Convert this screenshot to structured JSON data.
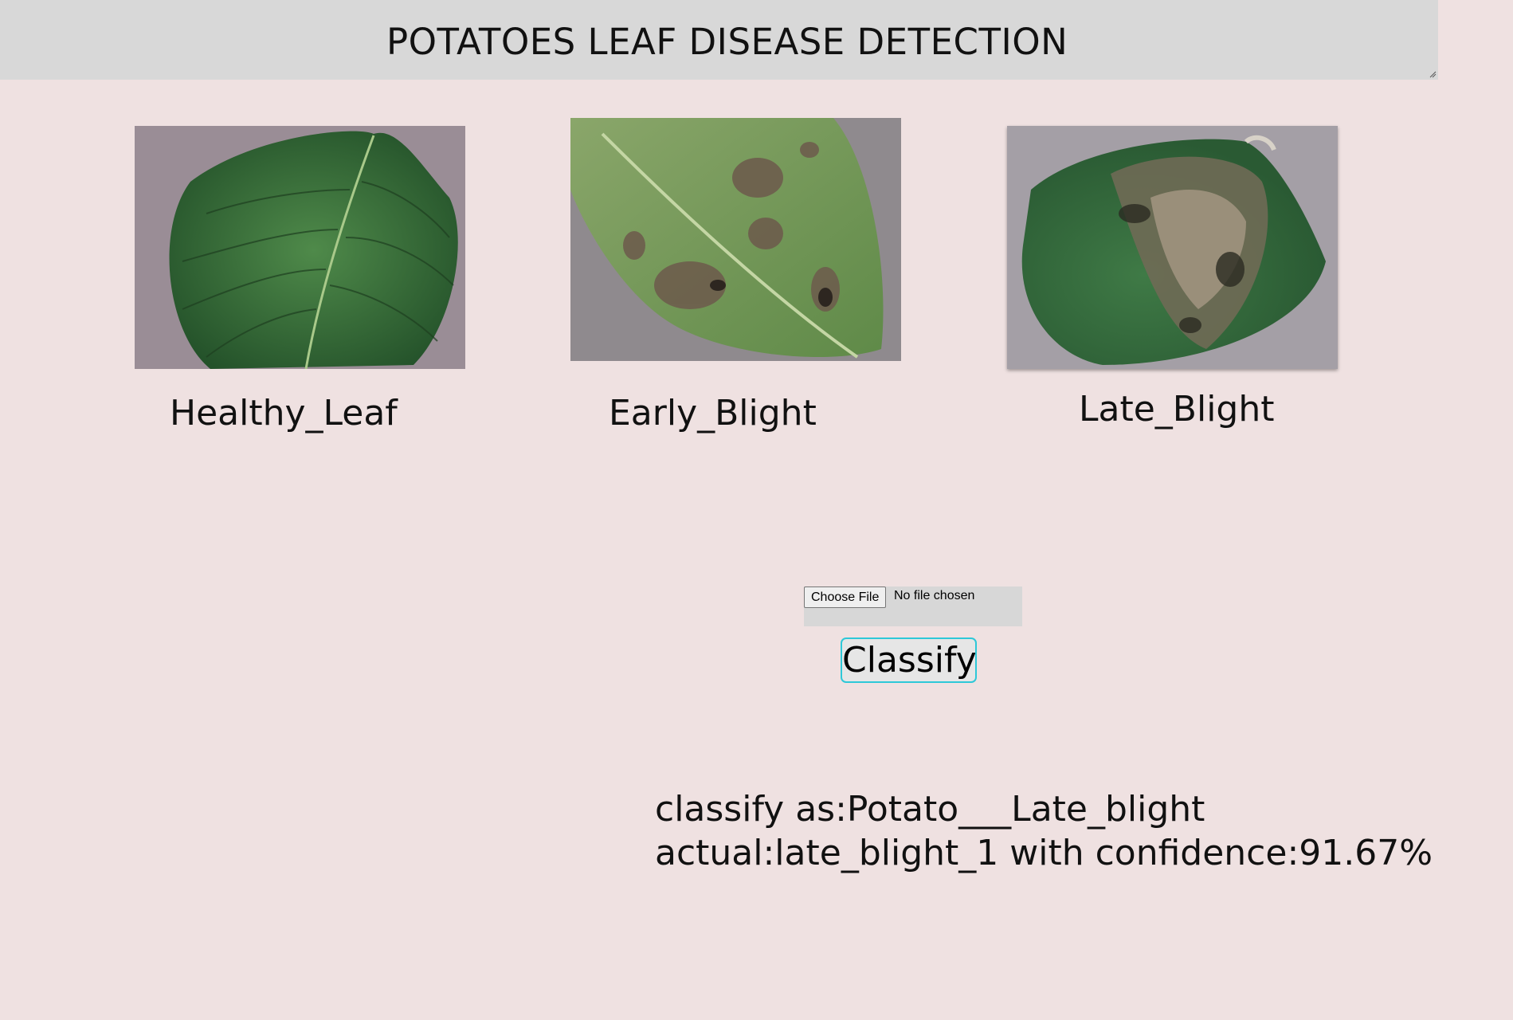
{
  "header": {
    "title": "POTATOES LEAF DISEASE DETECTION"
  },
  "samples": [
    {
      "label": "Healthy_Leaf"
    },
    {
      "label": "Early_Blight"
    },
    {
      "label": "Late_Blight"
    }
  ],
  "upload": {
    "button_label": "Choose File",
    "status": "No file chosen"
  },
  "classify_button": "Classify",
  "result": {
    "line1": "classify as:Potato___Late_blight",
    "line2": "actual:late_blight_1 with confidence:91.67%"
  }
}
